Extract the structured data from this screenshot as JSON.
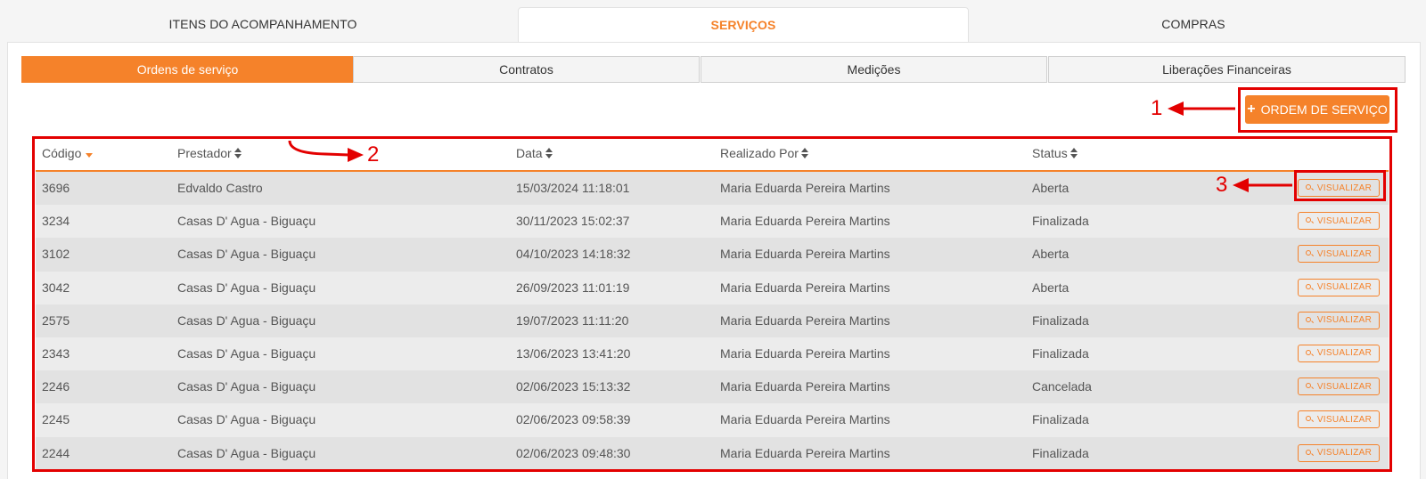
{
  "top_tabs": [
    {
      "label": "ITENS DO ACOMPANHAMENTO",
      "active": false
    },
    {
      "label": "SERVIÇOS",
      "active": true
    },
    {
      "label": "COMPRAS",
      "active": false
    }
  ],
  "sub_tabs": [
    {
      "label": "Ordens de serviço",
      "active": true
    },
    {
      "label": "Contratos",
      "active": false
    },
    {
      "label": "Medições",
      "active": false
    },
    {
      "label": "Liberações Financeiras",
      "active": false
    }
  ],
  "new_button": {
    "icon": "plus-icon",
    "label": "ORDEM DE SERVIÇO"
  },
  "table": {
    "headers": {
      "codigo": "Código",
      "prestador": "Prestador",
      "data": "Data",
      "realizado": "Realizado Por",
      "status": "Status"
    },
    "view_label": "VISUALIZAR",
    "rows": [
      {
        "codigo": "3696",
        "prestador": "Edvaldo Castro",
        "data": "15/03/2024 11:18:01",
        "realizado": "Maria Eduarda Pereira Martins",
        "status": "Aberta"
      },
      {
        "codigo": "3234",
        "prestador": "Casas D' Agua - Biguaçu",
        "data": "30/11/2023 15:02:37",
        "realizado": "Maria Eduarda Pereira Martins",
        "status": "Finalizada"
      },
      {
        "codigo": "3102",
        "prestador": "Casas D' Agua - Biguaçu",
        "data": "04/10/2023 14:18:32",
        "realizado": "Maria Eduarda Pereira Martins",
        "status": "Aberta"
      },
      {
        "codigo": "3042",
        "prestador": "Casas D' Agua - Biguaçu",
        "data": "26/09/2023 11:01:19",
        "realizado": "Maria Eduarda Pereira Martins",
        "status": "Aberta"
      },
      {
        "codigo": "2575",
        "prestador": "Casas D' Agua - Biguaçu",
        "data": "19/07/2023 11:11:20",
        "realizado": "Maria Eduarda Pereira Martins",
        "status": "Finalizada"
      },
      {
        "codigo": "2343",
        "prestador": "Casas D' Agua - Biguaçu",
        "data": "13/06/2023 13:41:20",
        "realizado": "Maria Eduarda Pereira Martins",
        "status": "Finalizada"
      },
      {
        "codigo": "2246",
        "prestador": "Casas D' Agua - Biguaçu",
        "data": "02/06/2023 15:13:32",
        "realizado": "Maria Eduarda Pereira Martins",
        "status": "Cancelada"
      },
      {
        "codigo": "2245",
        "prestador": "Casas D' Agua - Biguaçu",
        "data": "02/06/2023 09:58:39",
        "realizado": "Maria Eduarda Pereira Martins",
        "status": "Finalizada"
      },
      {
        "codigo": "2244",
        "prestador": "Casas D' Agua - Biguaçu",
        "data": "02/06/2023 09:48:30",
        "realizado": "Maria Eduarda Pereira Martins",
        "status": "Finalizada"
      }
    ]
  },
  "annotations": {
    "one": "1",
    "two": "2",
    "three": "3"
  },
  "colors": {
    "accent": "#f5822a",
    "annotation": "#e30000"
  }
}
